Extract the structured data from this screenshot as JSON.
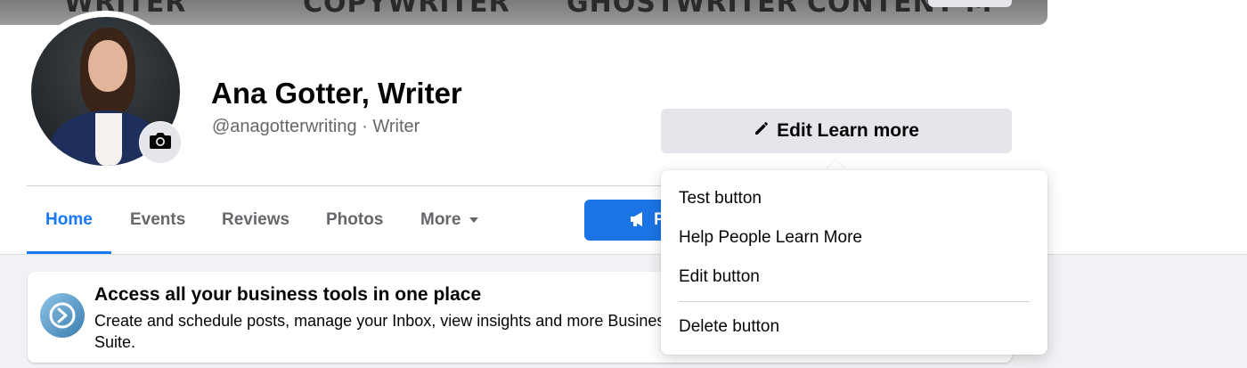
{
  "cover": {
    "words": [
      "WRITER",
      "COPYWRITER",
      "GHOSTWRITER",
      "CONTENT M"
    ]
  },
  "profile": {
    "name": "Ana Gotter, Writer",
    "handle": "@anagotterwriting · Writer"
  },
  "actions": {
    "edit_button_label": "Edit Learn more",
    "promote_label": "P"
  },
  "tabs": [
    {
      "label": "Home",
      "active": true
    },
    {
      "label": "Events",
      "active": false
    },
    {
      "label": "Reviews",
      "active": false
    },
    {
      "label": "Photos",
      "active": false
    },
    {
      "label": "More",
      "active": false
    }
  ],
  "business_card": {
    "title": "Access all your business tools in one place",
    "text": "Create and schedule posts, manage your Inbox, view insights and more Business Suite."
  },
  "dropdown": {
    "items": [
      "Test button",
      "Help People Learn More",
      "Edit button",
      "Delete button"
    ]
  },
  "colors": {
    "accent": "#1877f2",
    "button_gray": "#e4e6eb",
    "background": "#f0f2f5"
  }
}
